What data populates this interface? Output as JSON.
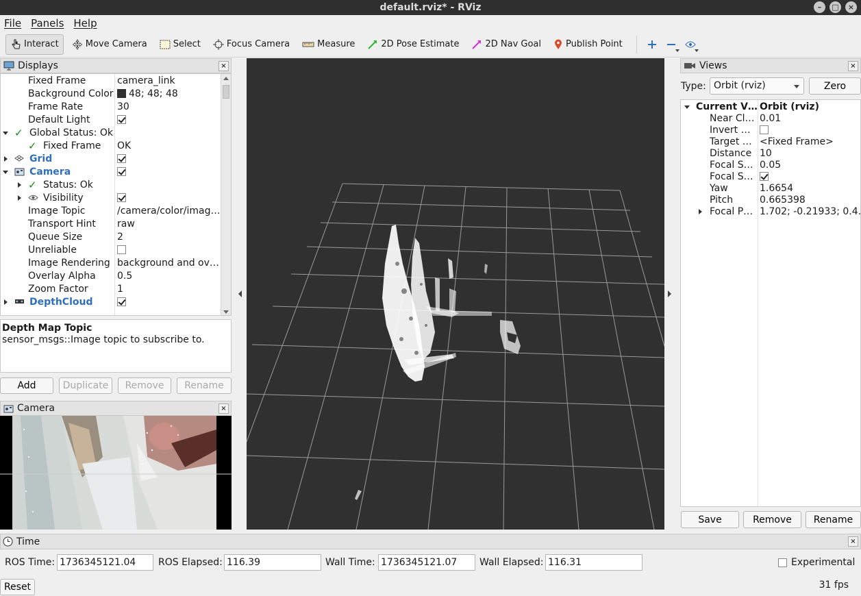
{
  "window": {
    "title": "default.rviz* - RViz"
  },
  "menu": [
    "File",
    "Panels",
    "Help"
  ],
  "toolbar": {
    "tools": [
      {
        "label": "Interact",
        "icon": "hand-pointer-icon",
        "active": true
      },
      {
        "label": "Move Camera",
        "icon": "move-camera-icon"
      },
      {
        "label": "Select",
        "icon": "select-rectangle-icon"
      },
      {
        "label": "Focus Camera",
        "icon": "focus-camera-icon"
      },
      {
        "label": "Measure",
        "icon": "ruler-icon"
      },
      {
        "label": "2D Pose Estimate",
        "icon": "green-arrow-icon"
      },
      {
        "label": "2D Nav Goal",
        "icon": "magenta-arrow-icon"
      },
      {
        "label": "Publish Point",
        "icon": "map-pin-icon"
      }
    ],
    "extra_icons": [
      "plus-icon",
      "minus-icon",
      "eye-icon"
    ]
  },
  "displays": {
    "title": "Displays",
    "rows": [
      {
        "name": "Fixed Frame",
        "value": "camera_link"
      },
      {
        "name": "Background Color",
        "value": "48; 48; 48"
      },
      {
        "name": "Frame Rate",
        "value": "30"
      },
      {
        "name": "Default Light",
        "value": ""
      },
      {
        "name": "Global Status: Ok",
        "value": ""
      },
      {
        "name": "Fixed Frame",
        "value": "OK"
      },
      {
        "name": "Grid",
        "value": ""
      },
      {
        "name": "Camera",
        "value": ""
      },
      {
        "name": "Status: Ok",
        "value": ""
      },
      {
        "name": "Visibility",
        "value": ""
      },
      {
        "name": "Image Topic",
        "value": "/camera/color/imag…"
      },
      {
        "name": "Transport Hint",
        "value": "raw"
      },
      {
        "name": "Queue Size",
        "value": "2"
      },
      {
        "name": "Unreliable",
        "value": ""
      },
      {
        "name": "Image Rendering",
        "value": "background and ov…"
      },
      {
        "name": "Overlay Alpha",
        "value": "0.5"
      },
      {
        "name": "Zoom Factor",
        "value": "1"
      },
      {
        "name": "DepthCloud",
        "value": ""
      }
    ],
    "description_title": "Depth Map Topic",
    "description_text": "sensor_msgs::Image topic to subscribe to.",
    "buttons": {
      "add": "Add",
      "duplicate": "Duplicate",
      "remove": "Remove",
      "rename": "Rename"
    }
  },
  "camera_panel": {
    "title": "Camera"
  },
  "views": {
    "title": "Views",
    "type_label": "Type:",
    "type_value": "Orbit (rviz)",
    "zero": "Zero",
    "rows": [
      {
        "name": "Current V…",
        "value": "Orbit (rviz)"
      },
      {
        "name": "Near Cl…",
        "value": "0.01"
      },
      {
        "name": "Invert …",
        "value": ""
      },
      {
        "name": "Target …",
        "value": "<Fixed Frame>"
      },
      {
        "name": "Distance",
        "value": "10"
      },
      {
        "name": "Focal S…",
        "value": "0.05"
      },
      {
        "name": "Focal S…",
        "value": ""
      },
      {
        "name": "Yaw",
        "value": "1.6654"
      },
      {
        "name": "Pitch",
        "value": "0.665398"
      },
      {
        "name": "Focal P…",
        "value": "1.702; -0.21933; 0.4…"
      }
    ],
    "buttons": {
      "save": "Save",
      "remove": "Remove",
      "rename": "Rename"
    }
  },
  "time": {
    "title": "Time",
    "ros_time_label": "ROS Time:",
    "ros_time": "1736345121.04",
    "ros_elapsed_label": "ROS Elapsed:",
    "ros_elapsed": "116.39",
    "wall_time_label": "Wall Time:",
    "wall_time": "1736345121.07",
    "wall_elapsed_label": "Wall Elapsed:",
    "wall_elapsed": "116.31",
    "experimental": "Experimental",
    "reset": "Reset",
    "fps": "31 fps"
  }
}
